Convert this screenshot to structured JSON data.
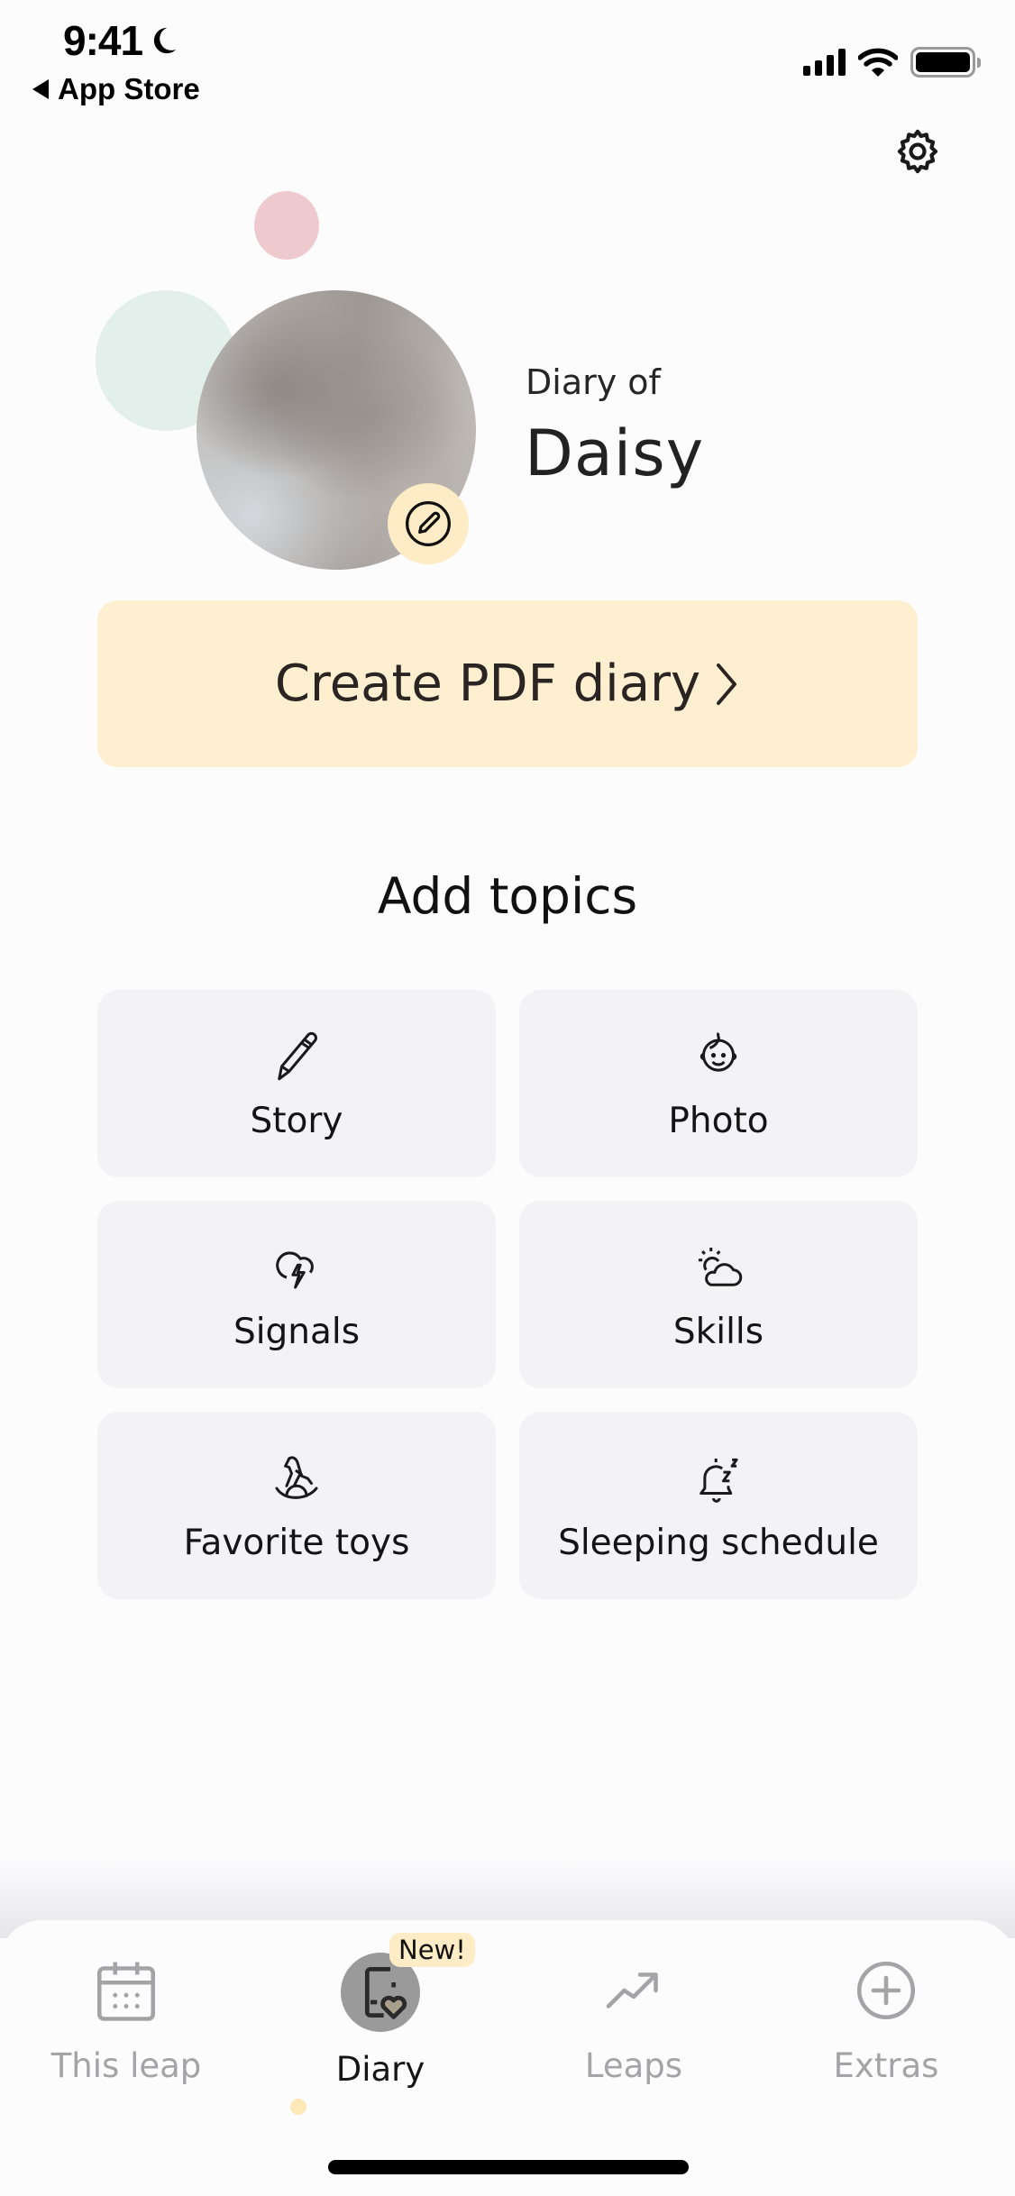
{
  "status_bar": {
    "time": "9:41",
    "back_label": "App Store",
    "icons": [
      "moon-icon",
      "signal-icon",
      "wifi-icon",
      "battery-icon"
    ]
  },
  "header": {
    "settings_icon": "gear-icon"
  },
  "profile": {
    "subtitle": "Diary of",
    "name": "Daisy",
    "edit_icon": "pencil-circle-icon"
  },
  "pdf_button": {
    "label": "Create PDF diary",
    "chevron": "›"
  },
  "topics_section": {
    "title": "Add topics",
    "items": [
      {
        "label": "Story",
        "icon": "pencil-icon"
      },
      {
        "label": "Photo",
        "icon": "baby-face-icon"
      },
      {
        "label": "Signals",
        "icon": "storm-cloud-icon"
      },
      {
        "label": "Skills",
        "icon": "sun-cloud-icon"
      },
      {
        "label": "Favorite toys",
        "icon": "rocking-horse-icon"
      },
      {
        "label": "Sleeping schedule",
        "icon": "sleeping-bell-icon"
      }
    ]
  },
  "tab_bar": {
    "active": "Diary",
    "tabs": [
      {
        "label": "This leap",
        "icon": "calendar-icon"
      },
      {
        "label": "Diary",
        "icon": "diary-heart-icon",
        "badge": "New!"
      },
      {
        "label": "Leaps",
        "icon": "trend-up-icon"
      },
      {
        "label": "Extras",
        "icon": "plus-circle-icon"
      }
    ]
  },
  "colors": {
    "accent_yellow": "#feefd0",
    "tile_bg": "#f3f2f5",
    "inactive_tab": "#a4a3a6",
    "decor_pink": "#eecace",
    "decor_mint": "#e2efea"
  }
}
